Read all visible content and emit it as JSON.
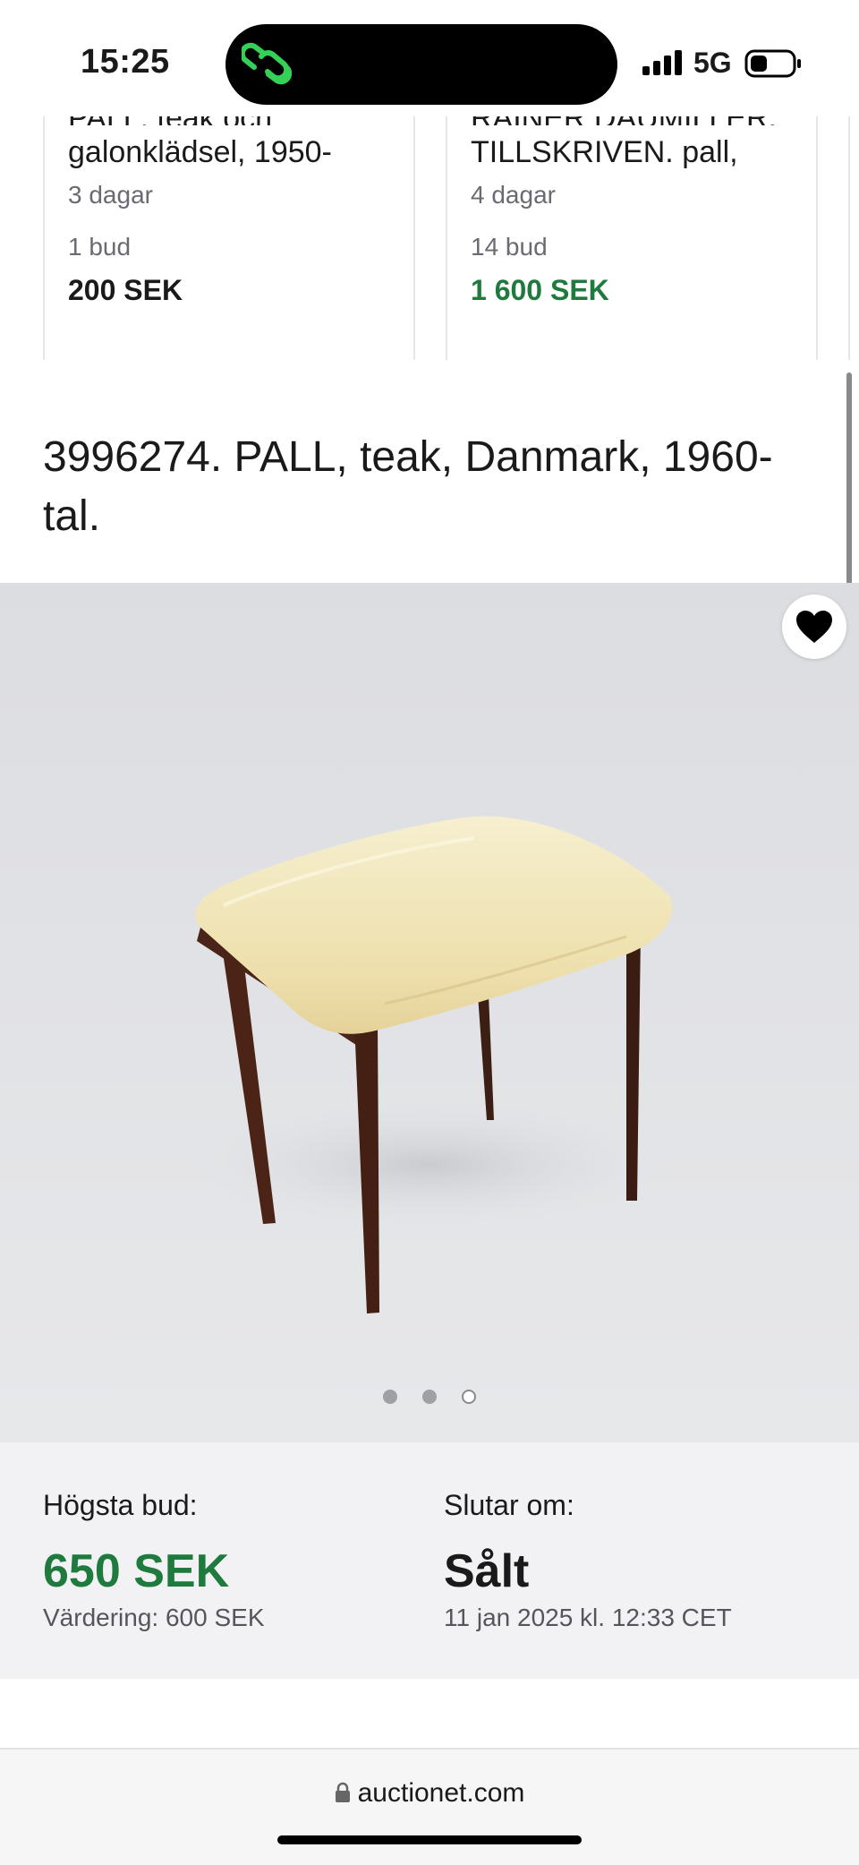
{
  "status_bar": {
    "time": "15:25",
    "network": "5G",
    "icons": [
      "app-link-icon",
      "signal-icon",
      "battery-icon"
    ]
  },
  "related_cards": [
    {
      "title_line1": "PALL, teak och",
      "title_line2": "galonklädsel, 1950-",
      "time_left": "3 dagar",
      "bids": "1 bud",
      "price": "200 SEK"
    },
    {
      "title_line1": "RAINER DAUMILLER.",
      "title_line2": "TILLSKRIVEN. pall,",
      "time_left": "4 dagar",
      "bids": "14 bud",
      "price": "1 600 SEK"
    }
  ],
  "lot": {
    "title": "3996274. PALL, teak, Danmark, 1960-tal."
  },
  "gallery": {
    "image_count": 3,
    "active_index": 2,
    "favorite_icon": "heart-icon"
  },
  "bid_info": {
    "highest_bid_label": "Högsta bud:",
    "highest_bid": "650 SEK",
    "estimate": "Värdering: 600 SEK",
    "ends_label": "Slutar om:",
    "status": "Sålt",
    "end_time": "11 jan 2025 kl. 12:33 CET"
  },
  "browser": {
    "url": "auctionet.com",
    "lock_icon": "lock-icon"
  },
  "colors": {
    "green": "#1f7a3e",
    "panel": "#f2f2f4"
  }
}
